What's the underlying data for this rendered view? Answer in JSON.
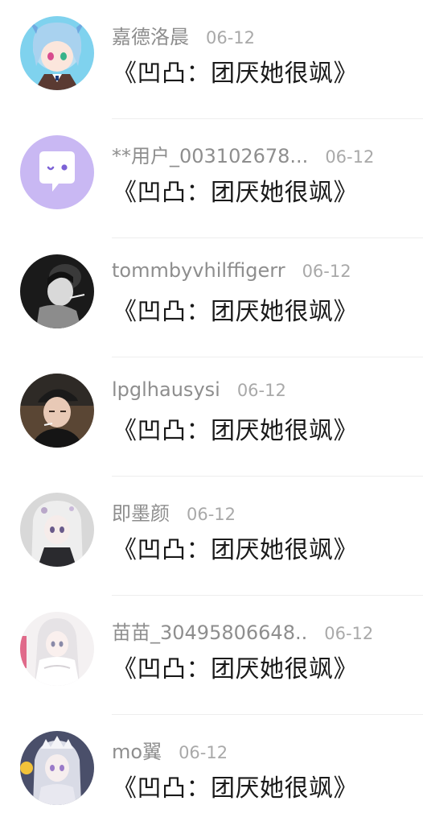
{
  "items": [
    {
      "username": "嘉德洛晨",
      "date": "06-12",
      "title": "《凹凸：团厌她很飒》",
      "avatar_icon": "anime-girl-blue-hair-avatar"
    },
    {
      "username": "**用户_003102678...",
      "date": "06-12",
      "title": "《凹凸：团厌她很飒》",
      "avatar_icon": "default-chat-bubble-avatar"
    },
    {
      "username": "tommbyvhilffigerr",
      "date": "06-12",
      "title": "《凹凸：团厌她很飒》",
      "avatar_icon": "dark-photo-avatar"
    },
    {
      "username": "lpglhausysi",
      "date": "06-12",
      "title": "《凹凸：团厌她很飒》",
      "avatar_icon": "man-with-cap-avatar"
    },
    {
      "username": "即墨颜",
      "date": "06-12",
      "title": "《凹凸：团厌她很飒》",
      "avatar_icon": "anime-girl-silver-hair-avatar"
    },
    {
      "username": "苗苗_30495806648..",
      "date": "06-12",
      "title": "《凹凸：团厌她很飒》",
      "avatar_icon": "anime-girl-white-dress-avatar"
    },
    {
      "username": "mo翼",
      "date": "06-12",
      "title": "《凹凸：团厌她很飒》",
      "avatar_icon": "anime-girl-crown-avatar"
    }
  ],
  "colors": {
    "username": "#8e8e8e",
    "date": "#a9a9a9",
    "title": "#1a1a1a",
    "default_avatar": "#c9b8f3"
  }
}
